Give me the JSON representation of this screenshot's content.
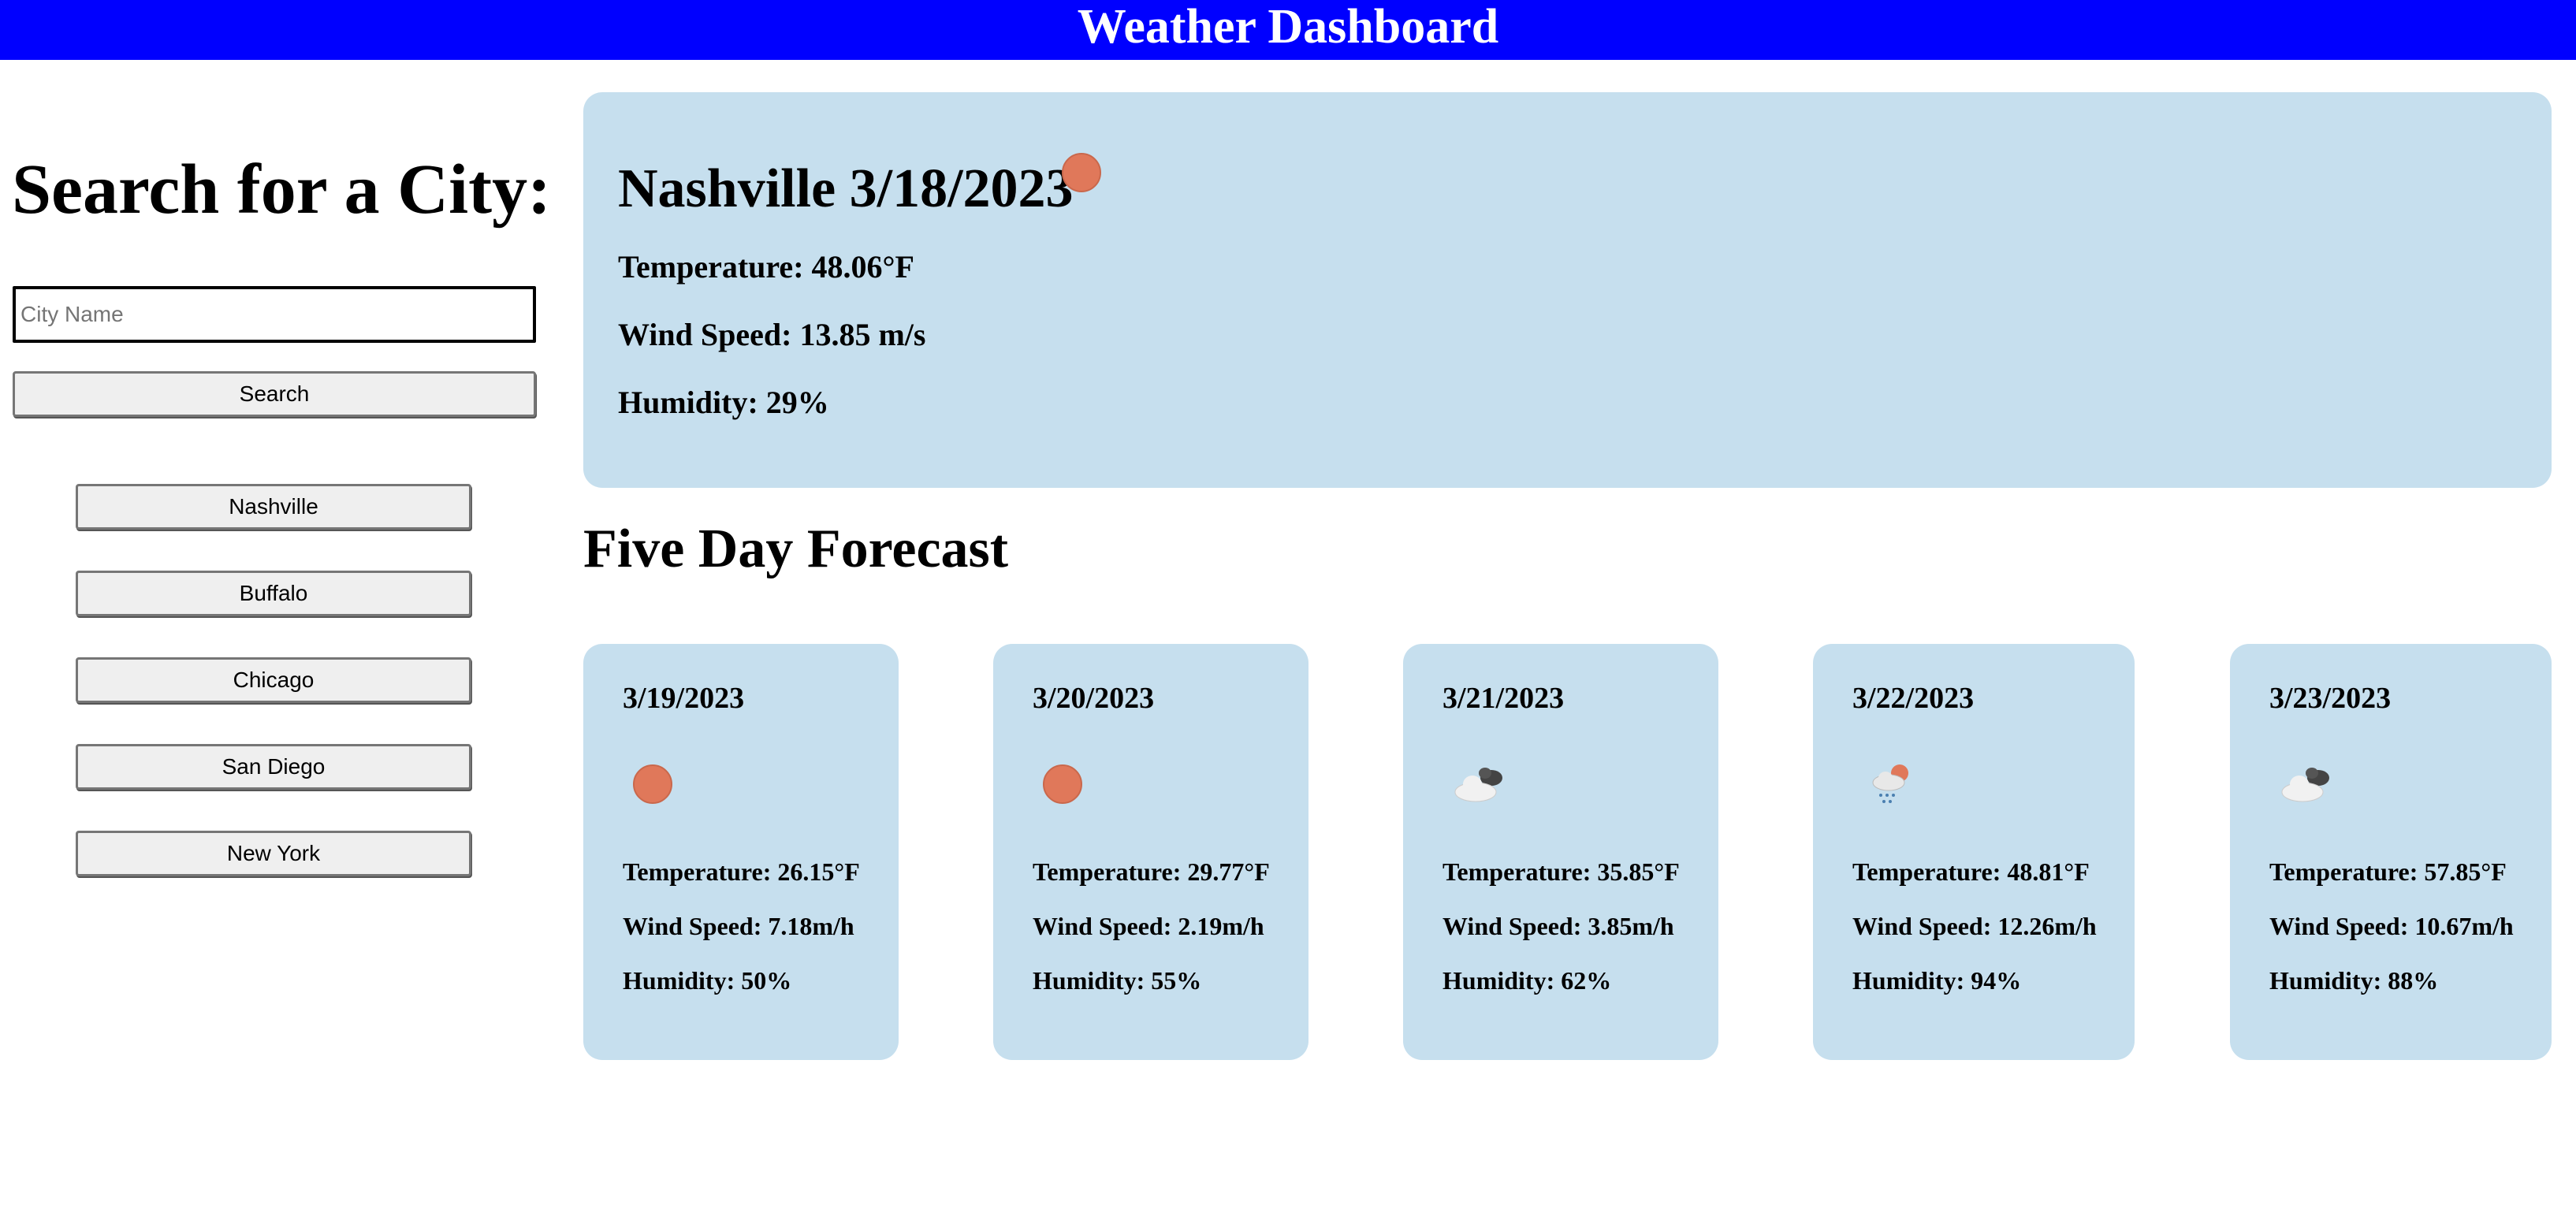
{
  "header": {
    "title": "Weather Dashboard",
    "bg_color": "#0000ff"
  },
  "sidebar": {
    "heading": "Search for a City:",
    "input": {
      "placeholder": "City Name",
      "value": ""
    },
    "search_label": "Search",
    "history": [
      "Nashville",
      "Buffalo",
      "Chicago",
      "San Diego",
      "New York"
    ]
  },
  "current": {
    "title": "Nashville 3/18/2023",
    "icon": "sun-icon",
    "temperature": "Temperature: 48.06°F",
    "wind": "Wind Speed: 13.85 m/s",
    "humidity": "Humidity: 29%"
  },
  "forecast": {
    "heading": "Five Day Forecast",
    "days": [
      {
        "date": "3/19/2023",
        "icon": "sun-icon",
        "temperature": "Temperature: 26.15°F",
        "wind": "Wind Speed: 7.18m/h",
        "humidity": "Humidity: 50%"
      },
      {
        "date": "3/20/2023",
        "icon": "sun-icon",
        "temperature": "Temperature: 29.77°F",
        "wind": "Wind Speed: 2.19m/h",
        "humidity": "Humidity: 55%"
      },
      {
        "date": "3/21/2023",
        "icon": "cloudy-icon",
        "temperature": "Temperature: 35.85°F",
        "wind": "Wind Speed: 3.85m/h",
        "humidity": "Humidity: 62%"
      },
      {
        "date": "3/22/2023",
        "icon": "rain-sun-icon",
        "temperature": "Temperature: 48.81°F",
        "wind": "Wind Speed: 12.26m/h",
        "humidity": "Humidity: 94%"
      },
      {
        "date": "3/23/2023",
        "icon": "cloudy-icon",
        "temperature": "Temperature: 57.85°F",
        "wind": "Wind Speed: 10.67m/h",
        "humidity": "Humidity: 88%"
      }
    ]
  },
  "colors": {
    "card_bg": "#c6dfee",
    "sun": "#e0785a"
  }
}
